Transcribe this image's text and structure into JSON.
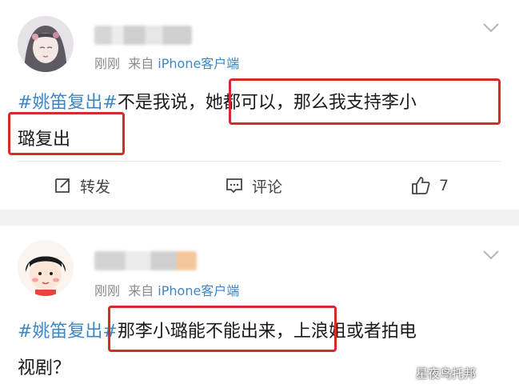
{
  "posts": [
    {
      "meta_time": "刚刚",
      "meta_from": "来自",
      "meta_source": "iPhone客户端",
      "topic": "#姚笛复出#",
      "text_part1": "不是我说，",
      "text_line1_rest": "她都可以，那么我支持李小",
      "text_line2": "璐复出",
      "actions": {
        "repost": "转发",
        "comment": "评论",
        "like_count": "7"
      }
    },
    {
      "meta_time": "刚刚",
      "meta_from": "来自",
      "meta_source": "iPhone客户端",
      "topic": "#姚笛复出#",
      "text_marked": "那李小璐能不能出来，",
      "text_line1_rest": "上浪姐或者拍电",
      "text_line2": "视剧？"
    }
  ],
  "watermark": "星夜鸟托邦",
  "colors": {
    "topic": "#3d86c6",
    "highlight_box": "#d62b2b",
    "separator": "#f2f2f2"
  },
  "icons": [
    "chevron-down-icon",
    "repost-icon",
    "comment-icon",
    "thumbs-up-icon"
  ]
}
